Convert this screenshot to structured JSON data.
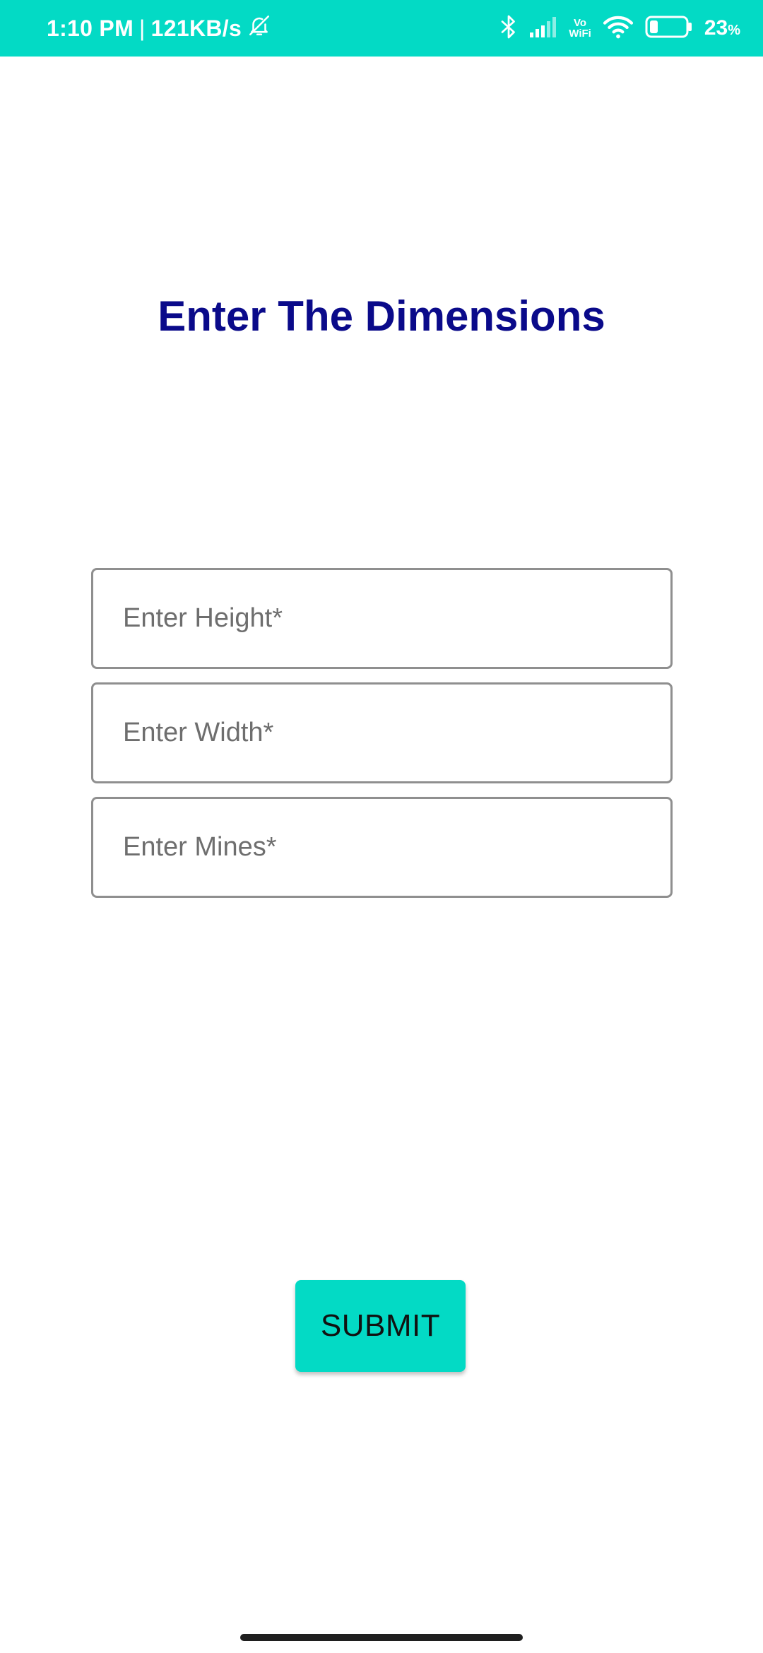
{
  "status_bar": {
    "time": "1:10 PM",
    "separator": "|",
    "network_speed": "121KB/s",
    "vowifi_top": "Vo",
    "vowifi_bottom": "WiFi",
    "battery_value": "23",
    "battery_unit": "%",
    "battery_level": 0.23,
    "background_color": "#03DAC5",
    "icons": [
      "mute-bell-icon",
      "bluetooth-icon",
      "cell-signal-icon",
      "wifi-icon",
      "battery-icon"
    ]
  },
  "form": {
    "title": "Enter The Dimensions",
    "title_color": "#0A0A8A",
    "height_placeholder": "Enter Height*",
    "width_placeholder": "Enter Width*",
    "mines_placeholder": "Enter Mines*",
    "submit_label": "SUBMIT",
    "accent_color": "#03DAC5"
  }
}
